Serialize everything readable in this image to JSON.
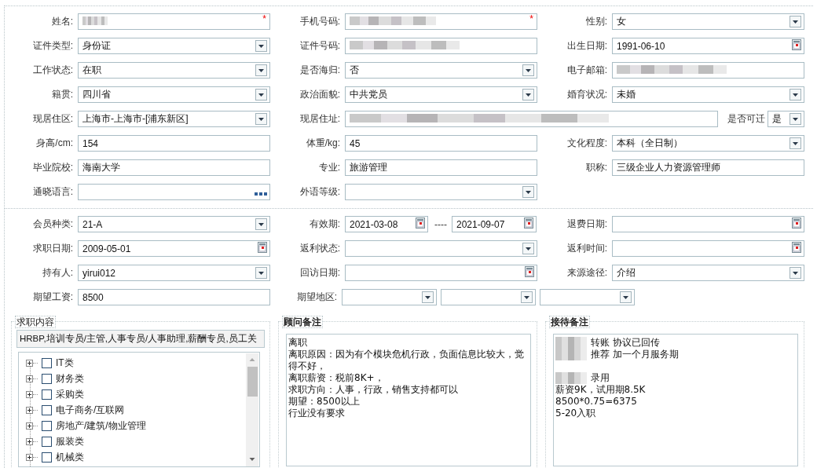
{
  "basic_info": {
    "rows": [
      [
        {
          "label": "姓名:",
          "kind": "text",
          "redacted": true,
          "marker": "*"
        },
        {
          "label": "手机号码:",
          "kind": "text",
          "redacted": true,
          "marker": "*"
        },
        {
          "label": "性别:",
          "kind": "select",
          "value": "女"
        }
      ],
      [
        {
          "label": "证件类型:",
          "kind": "select",
          "value": "身份证"
        },
        {
          "label": "证件号码:",
          "kind": "text",
          "redacted": true
        },
        {
          "label": "出生日期:",
          "kind": "date",
          "value": "1991-06-10"
        }
      ],
      [
        {
          "label": "工作状态:",
          "kind": "select",
          "value": "在职"
        },
        {
          "label": "是否海归:",
          "kind": "select",
          "value": "否"
        },
        {
          "label": "电子邮箱:",
          "kind": "text",
          "redacted": true
        }
      ],
      [
        {
          "label": "籍贯:",
          "kind": "select",
          "value": "四川省"
        },
        {
          "label": "政治面貌:",
          "kind": "select",
          "value": "中共党员"
        },
        {
          "label": "婚育状况:",
          "kind": "select",
          "value": "未婚"
        }
      ],
      [
        {
          "label": "现居住区:",
          "kind": "select",
          "value": "上海市-上海市-[浦东新区]"
        },
        {
          "label": "现居住址:",
          "kind": "long_text",
          "redacted": true
        },
        {
          "label": "是否可迁",
          "kind": "mini_select",
          "value": "是"
        }
      ],
      [
        {
          "label": "身高/cm:",
          "kind": "text",
          "value": "154"
        },
        {
          "label": "体重/kg:",
          "kind": "text",
          "value": "45"
        },
        {
          "label": "文化程度:",
          "kind": "select",
          "value": "本科（全日制）"
        }
      ],
      [
        {
          "label": "毕业院校:",
          "kind": "text",
          "value": "海南大学"
        },
        {
          "label": "专业:",
          "kind": "text",
          "value": "旅游管理"
        },
        {
          "label": "职称:",
          "kind": "text",
          "value": "三级企业人力资源管理师"
        }
      ],
      [
        {
          "label": "通晓语言:",
          "kind": "lookup"
        },
        {
          "label": "外语等级:",
          "kind": "select"
        }
      ]
    ]
  },
  "membership": {
    "rows": [
      [
        {
          "label": "会员种类:",
          "kind": "select",
          "value": "21-A"
        },
        {
          "label": "有效期:",
          "kind": "date_range",
          "values": [
            "2021-03-08",
            "2021-09-07"
          ],
          "separator": "----"
        },
        {
          "label": "退费日期:",
          "kind": "date"
        }
      ],
      [
        {
          "label": "求职日期:",
          "kind": "date",
          "value": "2009-05-01"
        },
        {
          "label": "返利状态:",
          "kind": "select"
        },
        {
          "label": "返利时间:",
          "kind": "date"
        }
      ],
      [
        {
          "label": "持有人:",
          "kind": "select",
          "value": "yirui012"
        },
        {
          "label": "回访日期:",
          "kind": "date"
        },
        {
          "label": "来源途径:",
          "kind": "select",
          "value": "介绍"
        }
      ],
      [
        {
          "label": "期望工资:",
          "kind": "text",
          "value": "8500"
        },
        {
          "label": "期望地区:",
          "kind": "select_group",
          "selects": [
            {
              "kind": "select"
            },
            {
              "kind": "select"
            },
            {
              "kind": "select"
            }
          ]
        }
      ]
    ]
  },
  "panels": [
    {
      "kind": "tree",
      "title": "求职内容",
      "bold_title": false,
      "summary": "HRBP,培训专员/主管,人事专员/人事助理,薪酬专员,员工关",
      "items": [
        {
          "label": "IT类",
          "checked": false,
          "expanded": false
        },
        {
          "label": "财务类",
          "checked": false,
          "expanded": false
        },
        {
          "label": "采购类",
          "checked": false,
          "expanded": false
        },
        {
          "label": "电子商务/互联网",
          "checked": false,
          "expanded": false
        },
        {
          "label": "房地产/建筑/物业管理",
          "checked": false,
          "expanded": false
        },
        {
          "label": "服装类",
          "checked": false,
          "expanded": false
        },
        {
          "label": "机械类",
          "checked": false,
          "expanded": false
        }
      ]
    },
    {
      "kind": "notes",
      "title": "顾问备注",
      "bold_title": true,
      "lines": [
        {
          "kind": "text",
          "text": "离职"
        },
        {
          "kind": "text",
          "text": "离职原因：因为有个模块危机行政，负面信息比较大，觉得不好，"
        },
        {
          "kind": "text",
          "text": "离职薪资：税前8K+，"
        },
        {
          "kind": "text",
          "text": "求职方向：人事，行政，销售支持都可以"
        },
        {
          "kind": "text",
          "text": "期望：8500以上"
        },
        {
          "kind": "text",
          "text": "行业没有要求"
        }
      ]
    },
    {
      "kind": "notes",
      "title": "接待备注",
      "bold_title": true,
      "lines": [
        {
          "kind": "text",
          "text": "转账 协议已回传",
          "redacted": true
        },
        {
          "kind": "text",
          "text": "推荐 加一个月服务期",
          "redacted": true
        },
        {
          "kind": "blank"
        },
        {
          "kind": "text",
          "text": "录用",
          "redacted": true
        },
        {
          "kind": "text",
          "text": "薪资9K，试用期8.5K"
        },
        {
          "kind": "text",
          "text": "8500*0.75=6375"
        },
        {
          "kind": "text",
          "text": "5-20入职"
        }
      ]
    }
  ]
}
